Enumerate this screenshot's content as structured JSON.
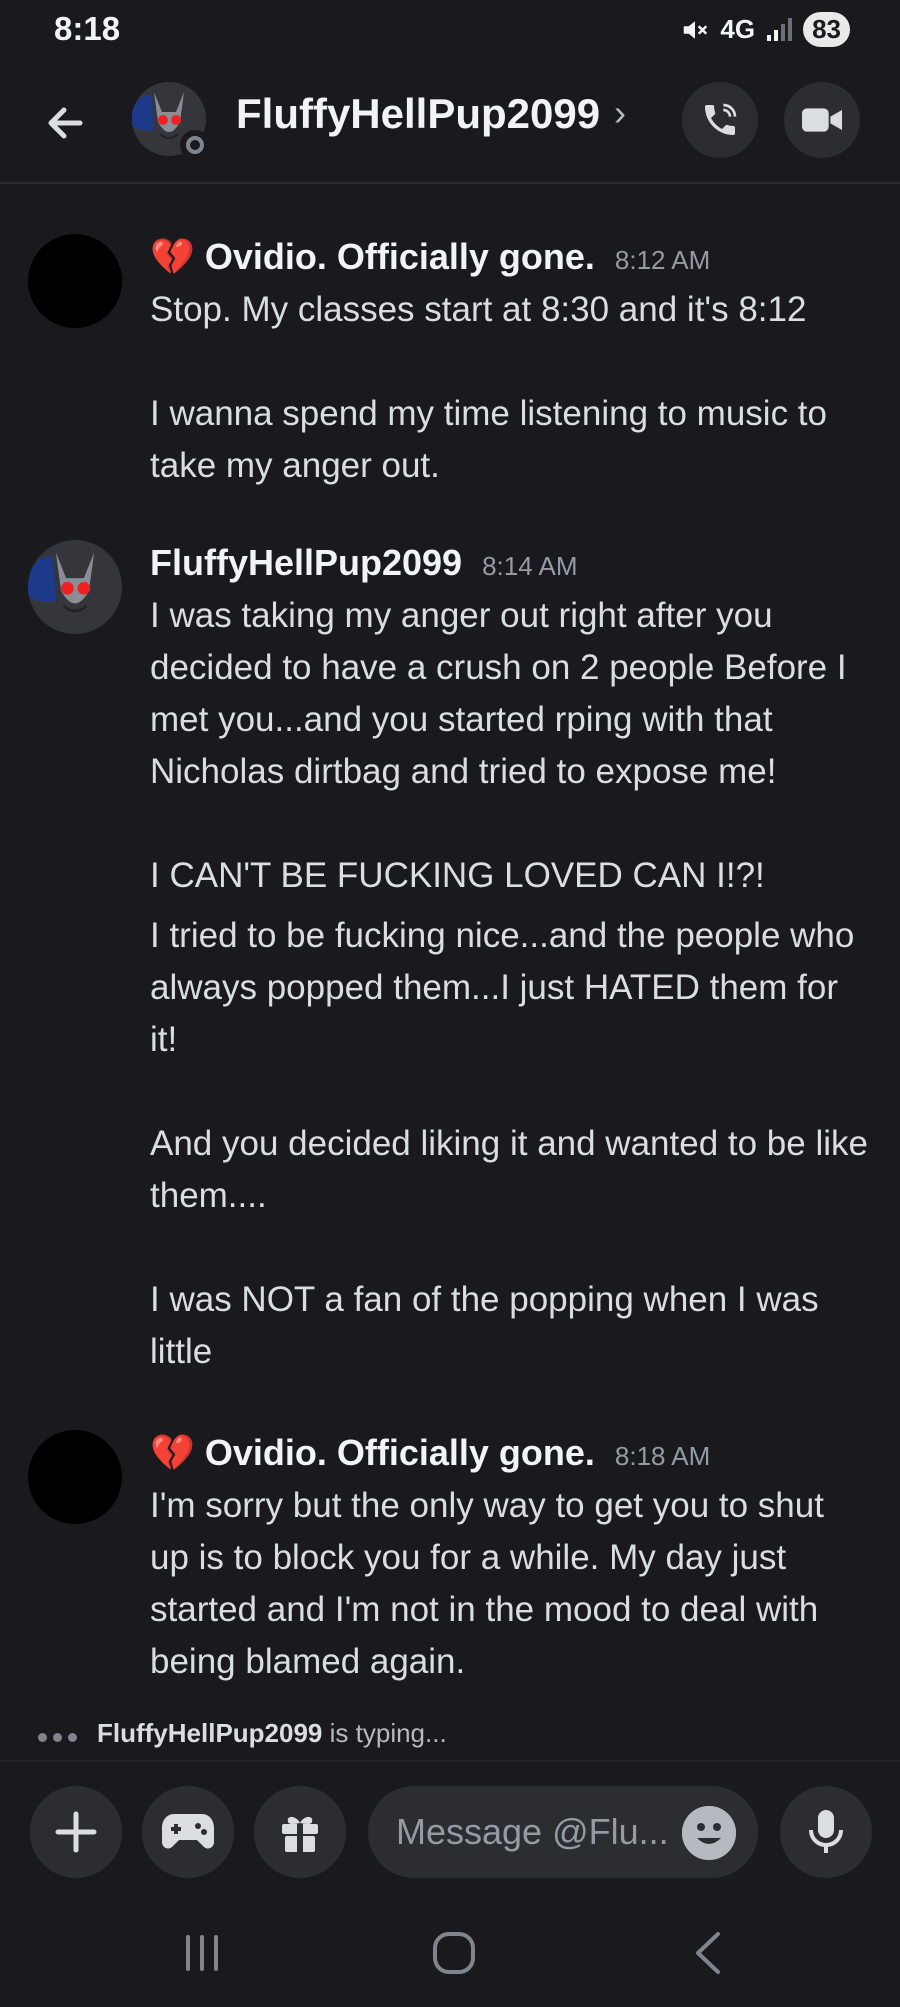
{
  "status_bar": {
    "time": "8:18",
    "network": "4G",
    "battery": "83"
  },
  "header": {
    "username": "FluffyHellPup2099",
    "icons": {
      "back": "arrow-left-icon",
      "call": "phone-call-icon",
      "video": "video-camera-icon"
    }
  },
  "messages": [
    {
      "author_emoji": "💔",
      "author": "Ovidio. Officially gone.",
      "time": "8:12 AM",
      "lines": [
        "Stop. My classes start at 8:30 and it's 8:12",
        "I wanna spend my time listening to music to take my anger out."
      ]
    },
    {
      "author": "FluffyHellPup2099",
      "time": "8:14 AM",
      "lines": [
        "I was taking my anger out right after you decided to have a crush on 2 people Before I met you...and you started rping with that Nicholas dirtbag and tried to expose me!",
        "I CAN'T BE FUCKING LOVED CAN I!?!",
        "I tried to be fucking nice...and the people who always popped them...I just HATED them for it!",
        "And you decided liking it and wanted to be like them....",
        "I was NOT a fan of the popping when I was little"
      ]
    },
    {
      "author_emoji": "💔",
      "author": "Ovidio. Officially gone.",
      "time": "8:18 AM",
      "lines": [
        "I'm sorry but the only way to get you to shut up is to block you for a while. My day just started and I'm not in the mood to deal with being blamed again."
      ]
    }
  ],
  "typing": {
    "user": "FluffyHellPup2099",
    "text": "is typing..."
  },
  "composer": {
    "placeholder": "Message @Flu..."
  }
}
